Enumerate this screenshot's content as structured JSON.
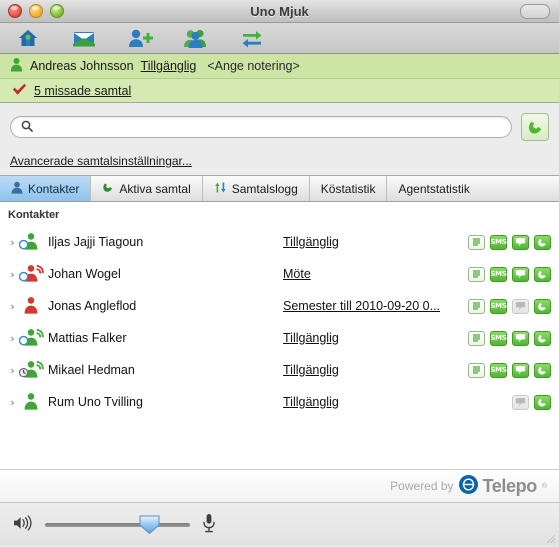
{
  "window": {
    "title": "Uno Mjuk",
    "traffic_lights": [
      "close-button",
      "minimize-button",
      "zoom-button"
    ],
    "toolbar_toggle": "toolbar-toggle-button"
  },
  "toolbar": {
    "buttons": [
      {
        "name": "home-icon",
        "label": "Hem"
      },
      {
        "name": "mail-icon",
        "label": "Meddelande"
      },
      {
        "name": "add-contact-icon",
        "label": "Lägg till kontakt"
      },
      {
        "name": "group-icon",
        "label": "Grupper"
      },
      {
        "name": "transfer-icon",
        "label": "Koppla"
      }
    ]
  },
  "presence": {
    "user_name": "Andreas Johnsson",
    "status": "Tillgänglig",
    "note_placeholder": "<Ange notering>",
    "missed_calls": "5 missade samtal"
  },
  "search": {
    "value": "",
    "placeholder": "",
    "advanced_link": "Avancerade samtalsinställningar...",
    "call_button": "call-button"
  },
  "tabs": [
    {
      "label": "Kontakter",
      "icon": "person-icon",
      "active": true
    },
    {
      "label": "Aktiva samtal",
      "icon": "phone-icon",
      "active": false
    },
    {
      "label": "Samtalslogg",
      "icon": "call-log-icon",
      "active": false
    },
    {
      "label": "Köstatistik",
      "icon": "",
      "active": false
    },
    {
      "label": "Agentstatistik",
      "icon": "",
      "active": false
    }
  ],
  "list": {
    "group_header": "Kontakter",
    "rows": [
      {
        "name": "Iljas Jajji Tiagoun",
        "status": "Tillgänglig",
        "presence": "available",
        "badge": "circle",
        "phone": "none",
        "actions": [
          "notes",
          "sms",
          "chat",
          "call"
        ],
        "chat_enabled": true,
        "notes_enabled": true,
        "sms_enabled": true
      },
      {
        "name": "Johan Wogel",
        "status": "Möte",
        "presence": "busy",
        "badge": "circle",
        "phone": "busy",
        "actions": [
          "notes",
          "sms",
          "chat",
          "call"
        ],
        "chat_enabled": true,
        "notes_enabled": true,
        "sms_enabled": true
      },
      {
        "name": "Jonas Angleflod",
        "status": "Semester till 2010-09-20 0...",
        "presence": "busy",
        "badge": "none",
        "phone": "none",
        "actions": [
          "notes",
          "sms",
          "chat",
          "call"
        ],
        "chat_enabled": false,
        "notes_enabled": true,
        "sms_enabled": true
      },
      {
        "name": "Mattias Falker",
        "status": "Tillgänglig",
        "presence": "available",
        "badge": "circle",
        "phone": "available",
        "actions": [
          "notes",
          "sms",
          "chat",
          "call"
        ],
        "chat_enabled": true,
        "notes_enabled": true,
        "sms_enabled": true
      },
      {
        "name": "Mikael Hedman",
        "status": "Tillgänglig",
        "presence": "available",
        "badge": "clock",
        "phone": "available",
        "actions": [
          "notes",
          "sms",
          "chat",
          "call"
        ],
        "chat_enabled": true,
        "notes_enabled": true,
        "sms_enabled": true
      },
      {
        "name": "Rum Uno Tvilling",
        "status": "Tillgänglig",
        "presence": "available",
        "badge": "none",
        "phone": "none",
        "actions": [
          "chat",
          "call"
        ],
        "chat_enabled": false,
        "notes_enabled": false,
        "sms_enabled": false
      }
    ],
    "action_labels": {
      "notes": "Anteckningar",
      "sms": "SMS",
      "chat": "Chatt",
      "call": "Ring"
    }
  },
  "footer": {
    "powered_by": "Powered by",
    "brand": "Telepo",
    "registered_mark": "®"
  },
  "bottom": {
    "speaker_icon": "speaker-icon",
    "microphone_icon": "microphone-icon",
    "volume_percent": 72
  },
  "colors": {
    "presence_green": "#cde5a4",
    "tab_active": "#8fc2ec",
    "accent_green": "#4fb830",
    "brand_blue": "#0b64a8",
    "available": "#3fa535",
    "busy": "#d03a32"
  }
}
